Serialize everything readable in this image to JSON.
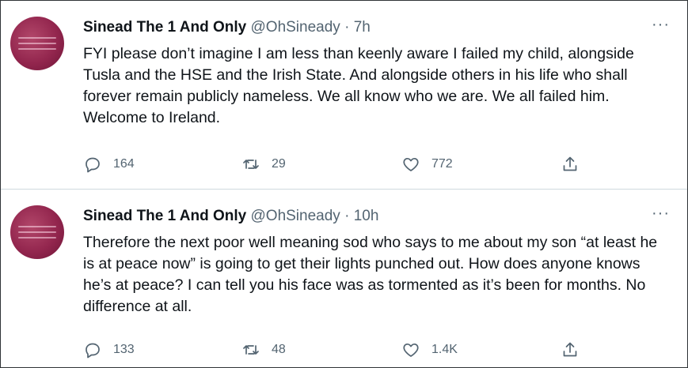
{
  "tweets": [
    {
      "author_name": "Sinead The 1 And Only",
      "handle": "@OhSineady",
      "separator": " · ",
      "time": "7h",
      "more": "···",
      "text": "FYI please don’t imagine I am less than keenly aware I failed my child, alongside Tusla and the HSE and the Irish State.  And alongside others in his life who shall forever remain publicly nameless.  We all know who we are. We all failed him.  Welcome to Ireland.",
      "replies": "164",
      "retweets": "29",
      "likes": "772"
    },
    {
      "author_name": "Sinead The 1 And Only",
      "handle": "@OhSineady",
      "separator": " · ",
      "time": "10h",
      "more": "···",
      "text": "Therefore the next poor well meaning sod who says to me about my son “at least he is at peace now” is going to get their lights punched out. How does anyone knows he’s at peace? I can tell you his face was as tormented as it’s been for months. No difference at all.",
      "replies": "133",
      "retweets": "48",
      "likes": "1.4K"
    }
  ],
  "icons": {
    "reply": "reply-icon",
    "retweet": "retweet-icon",
    "like": "heart-icon",
    "share": "share-icon",
    "more": "more-icon"
  },
  "colors": {
    "text": "#0f1419",
    "secondary": "#536471",
    "divider": "#cfd9de",
    "avatar": "#93264e"
  }
}
